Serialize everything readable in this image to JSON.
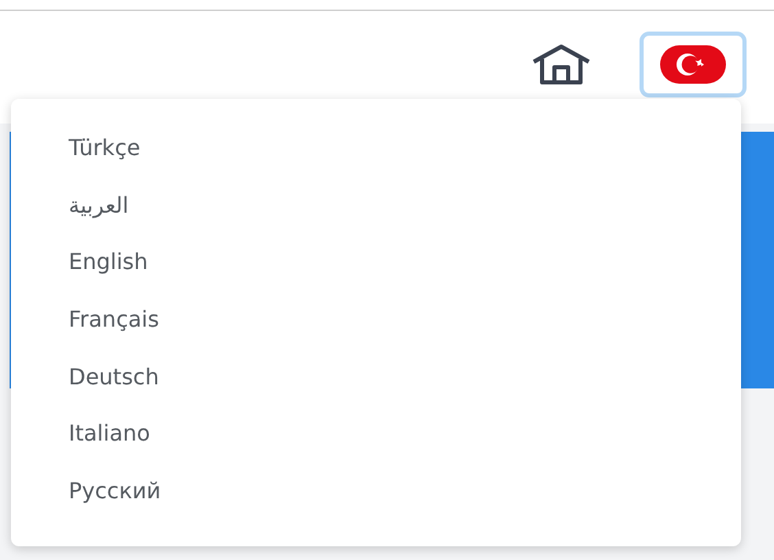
{
  "header": {
    "language_button": {
      "expanded": true
    }
  },
  "language_menu": {
    "items": [
      {
        "label": "Türkçe"
      },
      {
        "label": "العربية"
      },
      {
        "label": "English"
      },
      {
        "label": "Français"
      },
      {
        "label": "Deutsch"
      },
      {
        "label": "Italiano"
      },
      {
        "label": "Русский"
      }
    ]
  }
}
